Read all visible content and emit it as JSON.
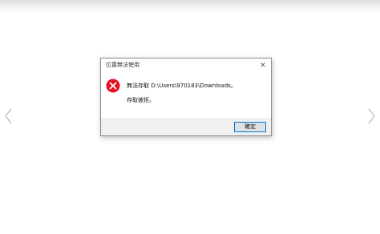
{
  "dialog": {
    "title": "位置無法使用",
    "close_glyph": "✕",
    "message": "無法存取 D:\\Users\\970183\\Downloads。",
    "detail": "存取被拒。",
    "ok_label": "確定"
  },
  "icons": {
    "error": "error-icon",
    "nav_left": "chevron-left-icon",
    "nav_right": "chevron-right-icon"
  },
  "colors": {
    "error_red": "#e81123",
    "button_focus_border": "#0078d7"
  }
}
